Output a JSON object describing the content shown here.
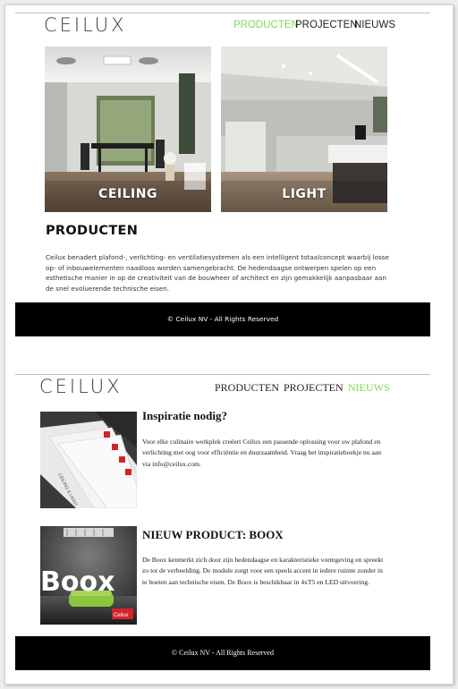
{
  "email1": {
    "logo": "CEILUX",
    "nav": [
      "PRODUCTEN",
      "PROJECTEN",
      "NIEUWS"
    ],
    "active_nav": "PRODUCTEN",
    "tiles": [
      {
        "label": "CEILING"
      },
      {
        "label": "LIGHT"
      }
    ],
    "heading": "PRODUCTEN",
    "paragraph": "Ceilux benadert plafond-, verlichting- en ventilatiesystemen als een intelligent totaalconcept waarbij losse op- of inbouwelementen naadloos worden samengebracht. De hedendaagse ontwerpen spelen op een esthetische manier in op de creativiteit van de bouwheer of architect en zijn gemakkelijk aanpasbaar aan de snel evoluerende technische eisen.",
    "footer": "© Ceilux NV - All Rights Reserved"
  },
  "email2": {
    "logo": "CEILUX",
    "nav": [
      "PRODUCTEN",
      "PROJECTEN",
      "NIEUWS"
    ],
    "active_nav": "NIEUWS",
    "articles": [
      {
        "title": "Inspiratie nodig?",
        "body": "Voor elke culinaire werkplek creëert Ceilux een passende oplossing voor uw plafond en verlichting met oog voor efficiëntie en duurzaamheid. Vraag het inspiratieboekje nu aan via info@ceilux.com.",
        "image_text": "CEILING & LIGHT"
      },
      {
        "title": "NIEUW PRODUCT: BOOX",
        "body": "De Boox kenmerkt zich door zijn hedendaagse en karakteristieke vormgeving en spreekt zo tot de verbeelding. De module zorgt voor een speels accent in iedere ruimte zonder in te boeten aan technische eisen. De Boox is beschikbaar in 4xT5 en LED uitvoering.",
        "image_text": "Boox",
        "badge_text": "Ceilux"
      }
    ],
    "footer": "© Ceilux NV - All Rights Reserved"
  },
  "colors": {
    "accent_green": "#7ed957",
    "footer_bg": "#000000",
    "brand_red": "#d2232a"
  }
}
